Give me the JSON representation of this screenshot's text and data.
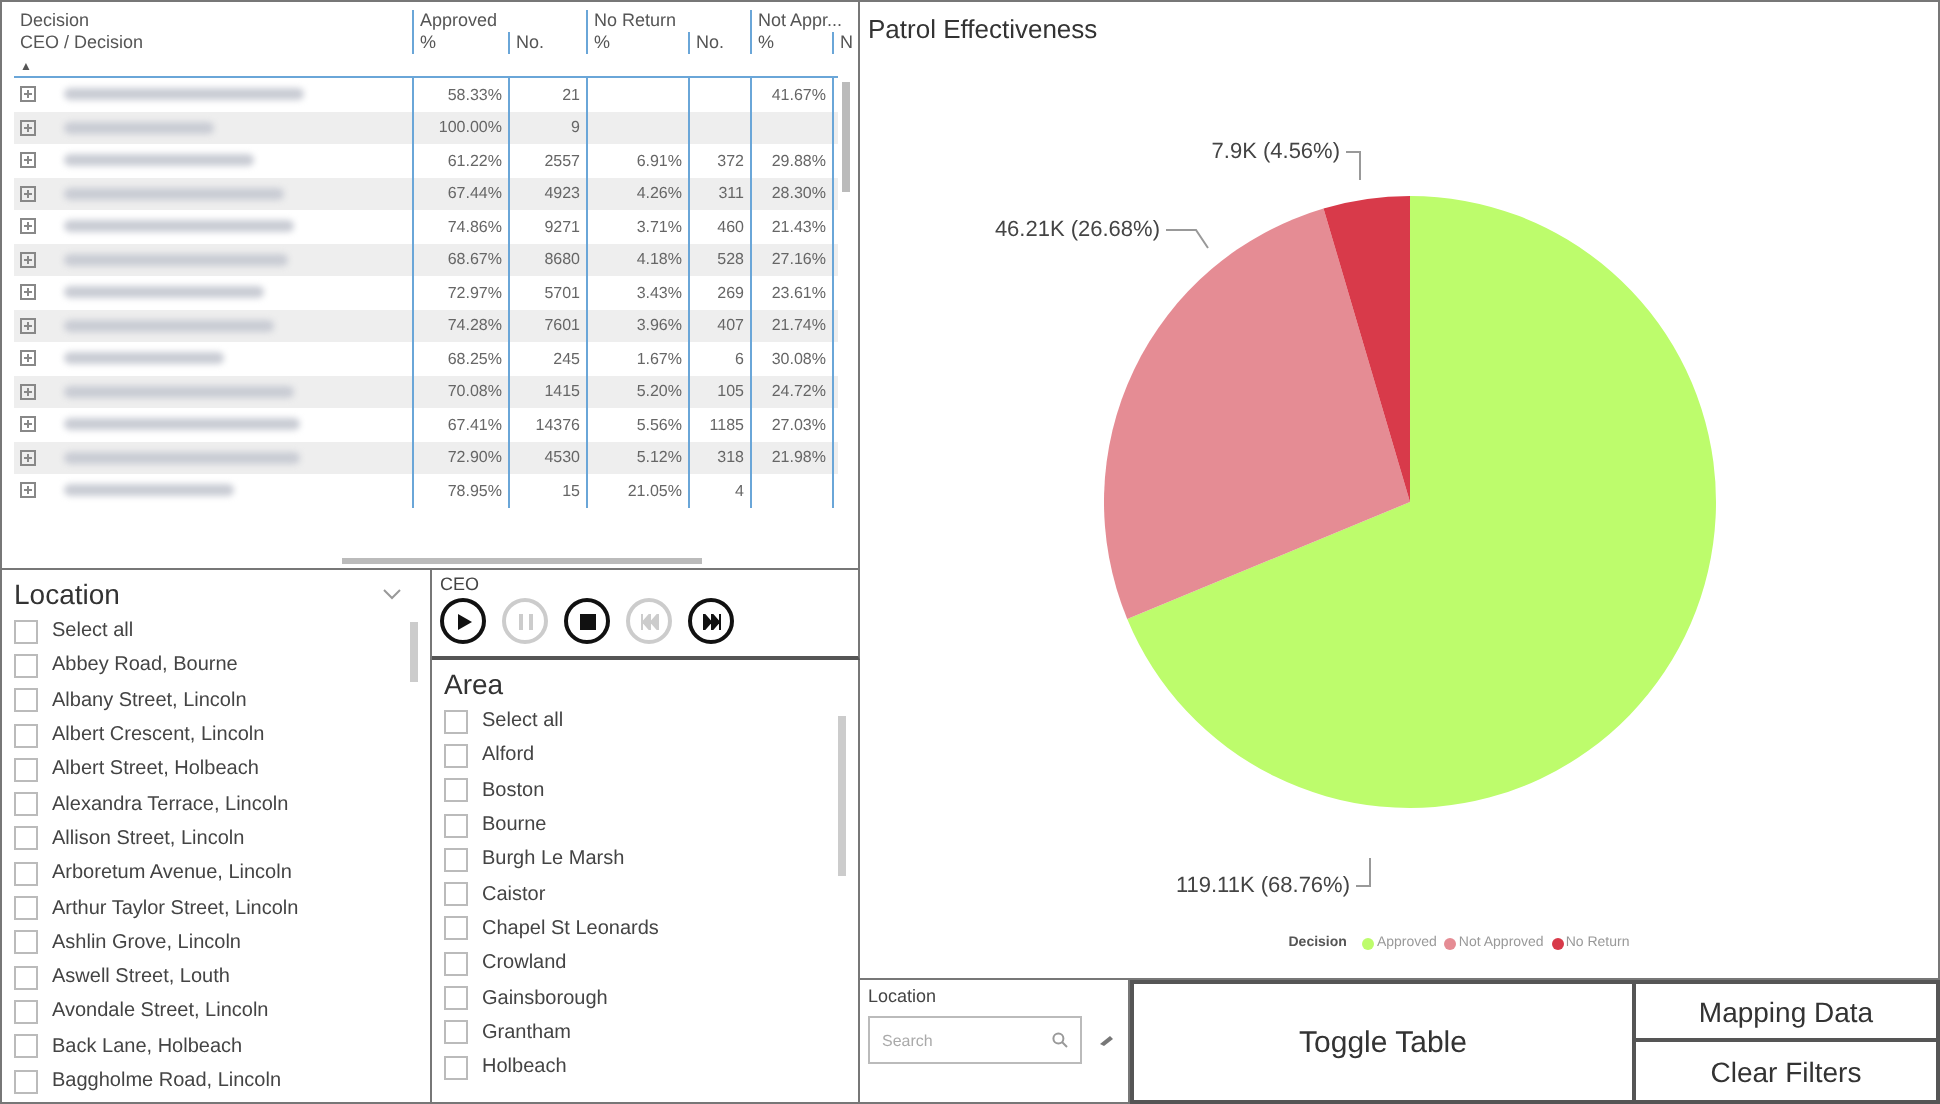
{
  "table": {
    "header_row_1": [
      "Decision",
      "Approved",
      "No Return",
      "Not Appr..."
    ],
    "header_row_2": [
      "CEO / Decision",
      "%",
      "No.",
      "%",
      "No.",
      "%",
      "N"
    ],
    "sort_indicator": "▲",
    "rows": [
      {
        "cells": [
          "58.33%",
          "21",
          "",
          "",
          "41.67%"
        ]
      },
      {
        "cells": [
          "100.00%",
          "9",
          "",
          "",
          ""
        ]
      },
      {
        "cells": [
          "61.22%",
          "2557",
          "6.91%",
          "372",
          "29.88%"
        ]
      },
      {
        "cells": [
          "67.44%",
          "4923",
          "4.26%",
          "311",
          "28.30%"
        ]
      },
      {
        "cells": [
          "74.86%",
          "9271",
          "3.71%",
          "460",
          "21.43%"
        ]
      },
      {
        "cells": [
          "68.67%",
          "8680",
          "4.18%",
          "528",
          "27.16%"
        ]
      },
      {
        "cells": [
          "72.97%",
          "5701",
          "3.43%",
          "269",
          "23.61%"
        ]
      },
      {
        "cells": [
          "74.28%",
          "7601",
          "3.96%",
          "407",
          "21.74%"
        ]
      },
      {
        "cells": [
          "68.25%",
          "245",
          "1.67%",
          "6",
          "30.08%"
        ]
      },
      {
        "cells": [
          "70.08%",
          "1415",
          "5.20%",
          "105",
          "24.72%"
        ]
      },
      {
        "cells": [
          "67.41%",
          "14376",
          "5.56%",
          "1185",
          "27.03%"
        ]
      },
      {
        "cells": [
          "72.90%",
          "4530",
          "5.12%",
          "318",
          "21.98%"
        ]
      },
      {
        "cells": [
          "78.95%",
          "15",
          "21.05%",
          "4",
          ""
        ]
      }
    ]
  },
  "location_slicer": {
    "title": "Location",
    "items": [
      {
        "label": "Select all",
        "checked": false
      },
      {
        "label": "Abbey Road, Bourne",
        "checked": false
      },
      {
        "label": "Albany Street, Lincoln",
        "checked": false
      },
      {
        "label": "Albert Crescent, Lincoln",
        "checked": false
      },
      {
        "label": "Albert Street, Holbeach",
        "checked": false
      },
      {
        "label": "Alexandra Terrace, Lincoln",
        "checked": false
      },
      {
        "label": "Allison Street, Lincoln",
        "checked": false
      },
      {
        "label": "Arboretum Avenue, Lincoln",
        "checked": false
      },
      {
        "label": "Arthur Taylor Street, Lincoln",
        "checked": false
      },
      {
        "label": "Ashlin Grove, Lincoln",
        "checked": false
      },
      {
        "label": "Aswell Street, Louth",
        "checked": false
      },
      {
        "label": "Avondale Street, Lincoln",
        "checked": false
      },
      {
        "label": "Back Lane, Holbeach",
        "checked": false
      },
      {
        "label": "Baggholme Road, Lincoln",
        "checked": false
      }
    ]
  },
  "ceo_player": {
    "title": "CEO",
    "buttons": [
      {
        "kind": "play",
        "disabled": false
      },
      {
        "kind": "pause",
        "disabled": true
      },
      {
        "kind": "stop",
        "disabled": false
      },
      {
        "kind": "previous",
        "disabled": true
      },
      {
        "kind": "next",
        "disabled": false
      }
    ]
  },
  "area_slicer": {
    "title": "Area",
    "items": [
      {
        "label": "Select all",
        "checked": false
      },
      {
        "label": "Alford",
        "checked": false
      },
      {
        "label": "Boston",
        "checked": false
      },
      {
        "label": "Bourne",
        "checked": false
      },
      {
        "label": "Burgh Le Marsh",
        "checked": false
      },
      {
        "label": "Caistor",
        "checked": false
      },
      {
        "label": "Chapel St Leonards",
        "checked": false
      },
      {
        "label": "Crowland",
        "checked": false
      },
      {
        "label": "Gainsborough",
        "checked": false
      },
      {
        "label": "Grantham",
        "checked": false
      },
      {
        "label": "Holbeach",
        "checked": false
      }
    ]
  },
  "chart": {
    "chart_data": {
      "type": "pie",
      "title": "Patrol Effectiveness",
      "categories": [
        "Approved",
        "Not Approved",
        "No Return"
      ],
      "series": [
        {
          "name": "Decision",
          "colors": [
            "#bdfc6c",
            "#e58c94",
            "#d83a4a"
          ],
          "values": [
            68.76,
            26.68,
            4.56
          ]
        }
      ],
      "value_labels": [
        "119.11K (68.76%)",
        "46.21K (26.68%)",
        "7.9K (4.56%)"
      ]
    }
  },
  "location_search": {
    "title": "Location",
    "placeholder": "Search"
  },
  "buttons": {
    "toggle": "Toggle Table",
    "mapping": "Mapping Data",
    "clear": "Clear Filters"
  }
}
